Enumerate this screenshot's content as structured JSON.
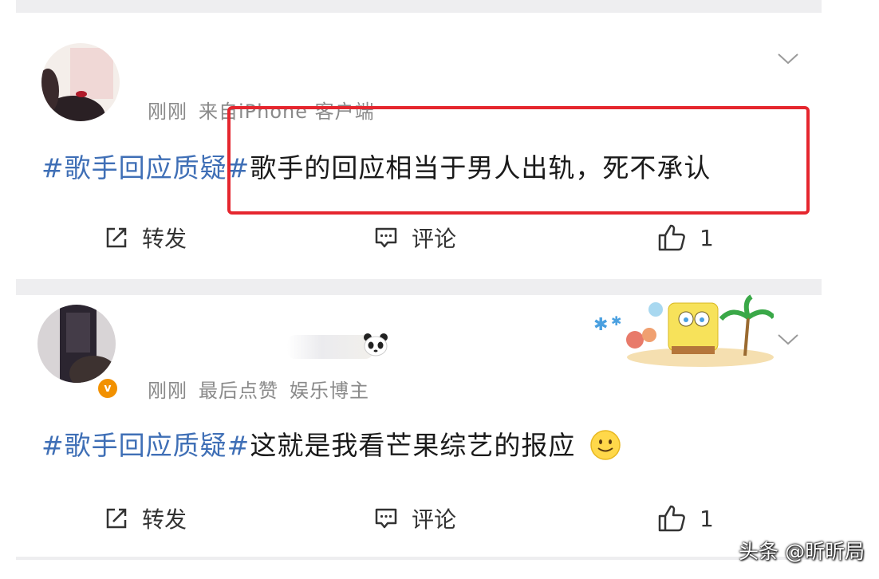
{
  "posts": [
    {
      "meta": {
        "time": "刚刚",
        "source": "来自iPhone 客户端"
      },
      "content": {
        "hashtag": "#歌手回应质疑#",
        "text": "歌手的回应相当于男人出轨，死不承认"
      },
      "actions": {
        "repost": "转发",
        "comment": "评论",
        "likes": "1"
      }
    },
    {
      "meta": {
        "time": "刚刚",
        "note": "最后点赞",
        "role": "娱乐博主"
      },
      "badge": "v",
      "content": {
        "hashtag": "#歌手回应质疑#",
        "text": "这就是我看芒果综艺的报应"
      },
      "actions": {
        "repost": "转发",
        "comment": "评论",
        "likes": "1"
      }
    }
  ],
  "watermark": "头条 @昕昕局",
  "colors": {
    "hashtag": "#3f6fb6",
    "highlight_border": "#e5262e",
    "vip_badge": "#f29100",
    "separator": "#eeeef0"
  },
  "icons": [
    "chevron-down-icon",
    "repost-icon",
    "comment-icon",
    "like-icon",
    "panda-icon",
    "smile-emoji-icon"
  ]
}
